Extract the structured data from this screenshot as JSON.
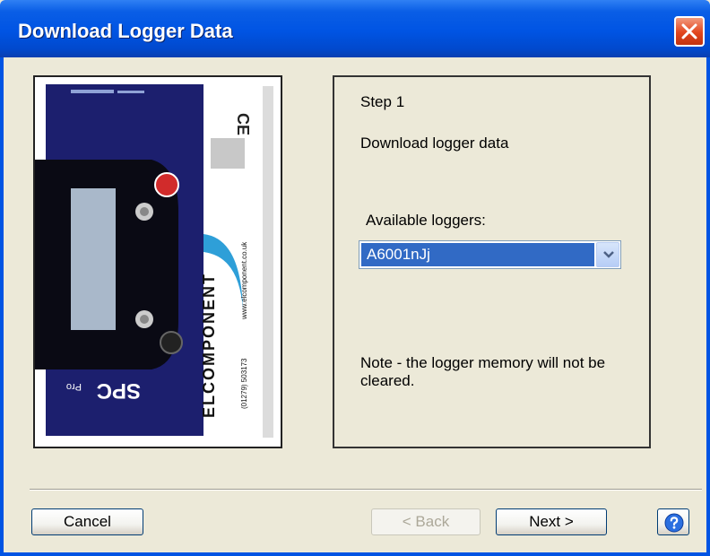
{
  "window": {
    "title": "Download Logger Data"
  },
  "step": {
    "label": "Step 1",
    "description": "Download logger data",
    "loggers_label": "Available loggers:",
    "selected_logger": "A6001nJj",
    "note": "Note - the logger memory will not be cleared."
  },
  "device": {
    "model": "SPC Pro",
    "brand": "ELCOMPONENT",
    "website": "www.elcomponent.co.uk",
    "phone": "(01279) 503173",
    "mark": "CE"
  },
  "buttons": {
    "cancel": "Cancel",
    "back": "< Back",
    "next": "Next >"
  },
  "icons": {
    "close": "close-icon",
    "dropdown": "chevron-down-icon",
    "help": "help-icon"
  }
}
